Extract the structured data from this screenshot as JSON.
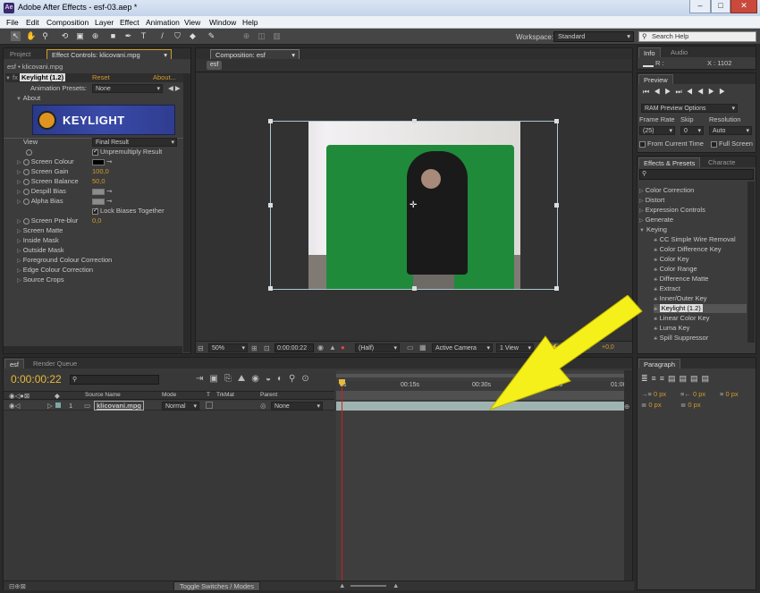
{
  "window": {
    "title": "Adobe After Effects - esf-03.aep *",
    "icon_label": "Ae",
    "min": "–",
    "max": "□",
    "close": "✕"
  },
  "menu": [
    "File",
    "Edit",
    "Composition",
    "Layer",
    "Effect",
    "Animation",
    "View",
    "Window",
    "Help"
  ],
  "toolbar": {
    "workspace_label": "Workspace:",
    "workspace_value": "Standard",
    "search_placeholder": "Search Help"
  },
  "left_panel": {
    "tabs": [
      "Project",
      "Effect Controls: klicovani.mpg"
    ],
    "breadcrumb": "esf • klicovani.mpg",
    "effect_name": "Keylight (1.2)",
    "reset": "Reset",
    "about_link": "About...",
    "animation_presets_label": "Animation Presets:",
    "animation_presets_value": "None",
    "about_label": "About",
    "logo_text": "KEYLIGHT",
    "view_label": "View",
    "view_value": "Final Result",
    "unpremultiply": "Unpremultiply Result",
    "screen_colour": "Screen Colour",
    "screen_gain": "Screen Gain",
    "screen_gain_val": "100,0",
    "screen_balance": "Screen Balance",
    "screen_balance_val": "50,0",
    "despill_bias": "Despill Bias",
    "alpha_bias": "Alpha Bias",
    "lock_biases": "Lock Biases Together",
    "screen_preblur": "Screen Pre-blur",
    "screen_preblur_val": "0,0",
    "groups": [
      "Screen Matte",
      "Inside Mask",
      "Outside Mask",
      "Foreground Colour Correction",
      "Edge Colour Correction",
      "Source Crops"
    ]
  },
  "comp_panel": {
    "tab": "Composition: esf",
    "subtab": "esf",
    "zoom": "50%",
    "timecode": "0:00:00:22",
    "resolution": "(Half)",
    "camera": "Active Camera",
    "views": "1 View",
    "exposure": "+0,0"
  },
  "info": {
    "tabs": [
      "Info",
      "Audio"
    ],
    "r": "R :",
    "x": "X : 1102"
  },
  "preview": {
    "title": "Preview",
    "ram_options": "RAM Preview Options",
    "frame_rate_label": "Frame Rate",
    "skip_label": "Skip",
    "resolution_label": "Resolution",
    "frame_rate": "(25)",
    "skip": "0",
    "resolution": "Auto",
    "from_current": "From Current Time",
    "full_screen": "Full Screen"
  },
  "effects": {
    "tabs": [
      "Effects & Presets",
      "Characte"
    ],
    "categories_top": [
      "Color Correction",
      "Distort",
      "Expression Controls",
      "Generate"
    ],
    "keying_label": "Keying",
    "keying_items": [
      "CC Simple Wire Removal",
      "Color Difference Key",
      "Color Key",
      "Color Range",
      "Difference Matte",
      "Extract",
      "Inner/Outer Key",
      "Keylight (1.2)",
      "Linear Color Key",
      "Luma Key",
      "Spill Suppressor"
    ],
    "selected": "Keylight (1.2)"
  },
  "timeline": {
    "tabs": [
      "esf",
      "Render Queue"
    ],
    "timecode": "0:00:00:22",
    "cols": {
      "source": "Source Name",
      "mode": "Mode",
      "t": "T",
      "trkmat": "TrkMat",
      "parent": "Parent"
    },
    "layer": {
      "num": "1",
      "name": "klicovani.mpg",
      "mode": "Normal",
      "parent": "None"
    },
    "ruler": [
      "0s",
      "00:15s",
      "00:30s",
      "00:45s",
      "01:00"
    ],
    "toggle": "Toggle Switches / Modes"
  },
  "paragraph": {
    "tabs": [
      "Paragraph"
    ],
    "values": [
      "0 px",
      "0 px",
      "0 px",
      "0 px",
      "0 px"
    ]
  },
  "colors": {
    "arrow": "#f5f01a",
    "green_screen": "#1f8a3a",
    "playhead": "#d02020",
    "accent_time": "#e8b83a"
  }
}
